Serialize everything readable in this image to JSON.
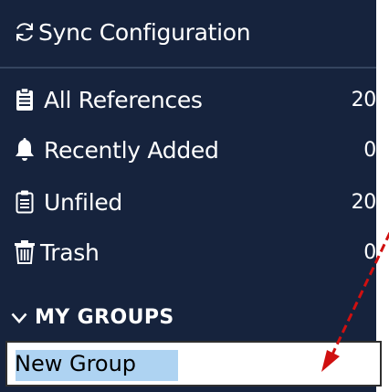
{
  "sidebar": {
    "sync": {
      "label": "Sync Configuration",
      "icon": "sync-icon"
    },
    "items": [
      {
        "label": "All References",
        "count": "20",
        "icon": "clipboard-icon"
      },
      {
        "label": "Recently Added",
        "count": "0",
        "icon": "bell-icon"
      },
      {
        "label": "Unfiled",
        "count": "20",
        "icon": "clipboard-icon"
      },
      {
        "label": "Trash",
        "count": "0",
        "icon": "trash-icon"
      }
    ],
    "groups_header": "MY GROUPS",
    "new_group_input": {
      "value": "New Group"
    }
  },
  "colors": {
    "sidebar_bg": "#16233d",
    "selection": "#aed3f2",
    "annotation_arrow": "#d01010"
  }
}
